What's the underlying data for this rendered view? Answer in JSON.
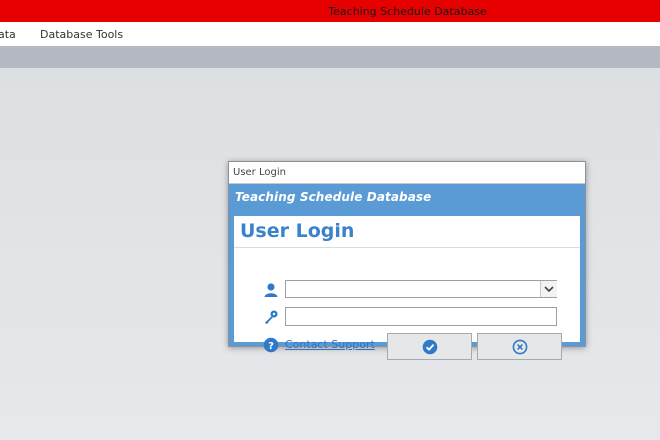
{
  "window": {
    "title": "Teaching Schedule Database"
  },
  "ribbon": {
    "tabs": [
      "ata",
      "Database Tools"
    ]
  },
  "login_dialog": {
    "caption": "User Login",
    "header": "Teaching Schedule Database",
    "title": "User Login",
    "username": {
      "value": "",
      "icon": "user-icon"
    },
    "password": {
      "value": "",
      "icon": "key-icon"
    },
    "support_link": "Contact Support",
    "ok_icon": "check-circle-icon",
    "cancel_icon": "x-circle-icon",
    "accent_color": "#5b9bd5"
  },
  "colors": {
    "titlebar": "#e60000",
    "accent": "#5b9bd5",
    "link": "#2e75c9"
  }
}
